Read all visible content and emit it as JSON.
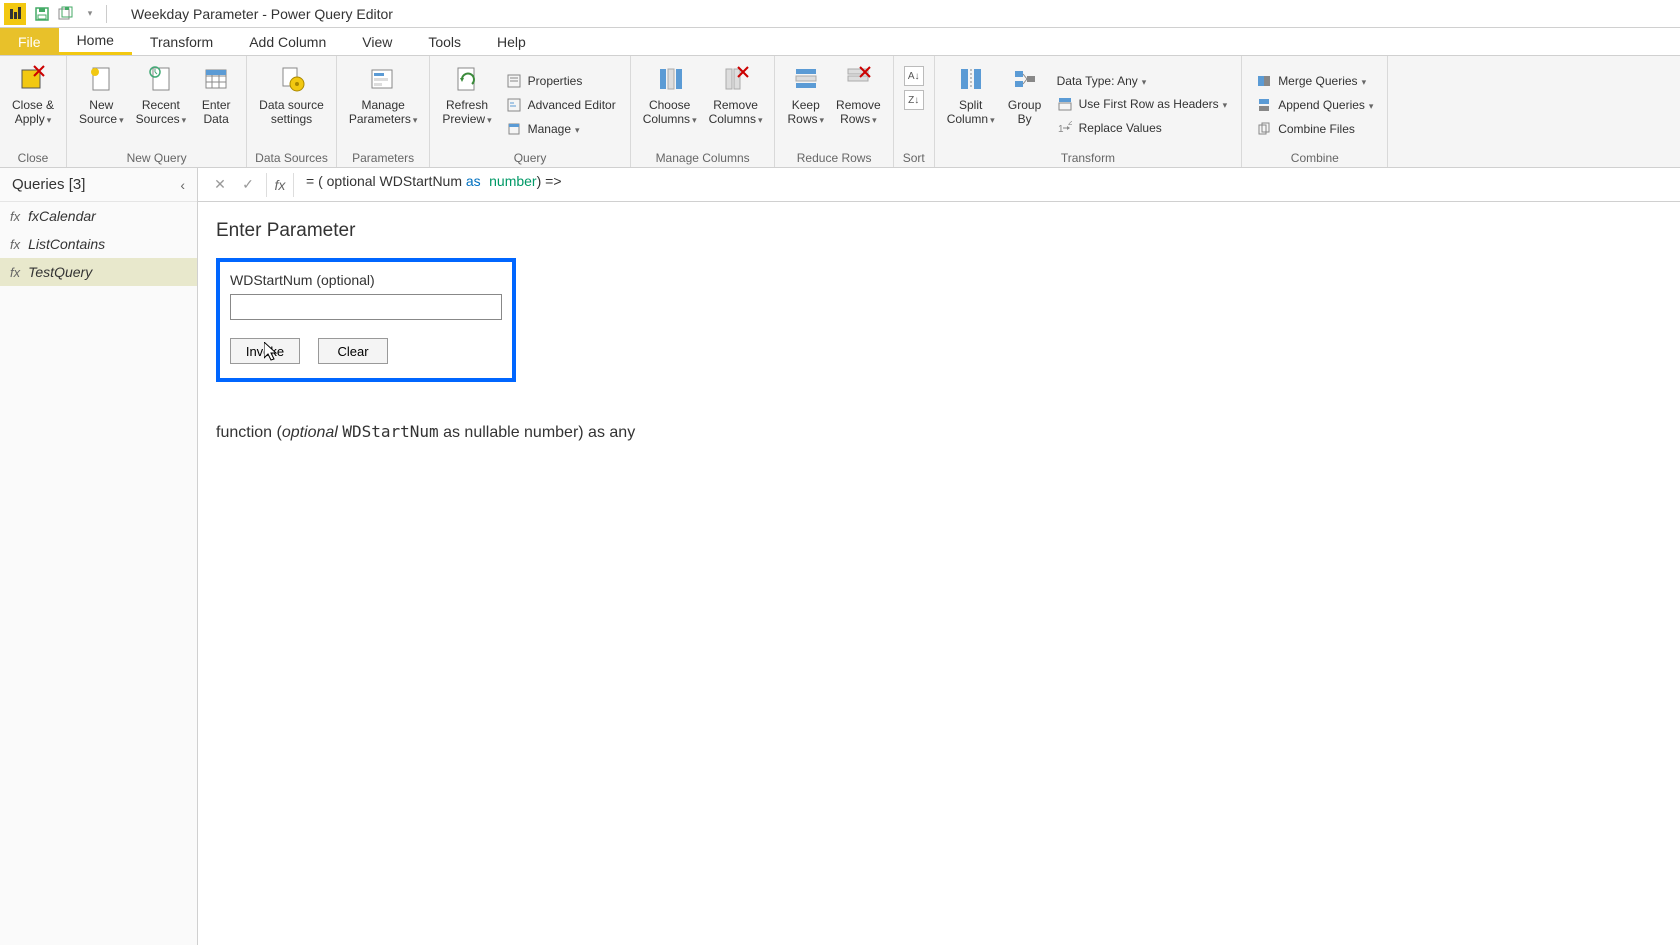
{
  "title": "Weekday Parameter - Power Query Editor",
  "tabs": {
    "file": "File",
    "home": "Home",
    "transform": "Transform",
    "addcol": "Add Column",
    "view": "View",
    "tools": "Tools",
    "help": "Help"
  },
  "ribbon": {
    "closeApply": "Close &\nApply",
    "closeGroup": "Close",
    "newSource": "New\nSource",
    "recentSources": "Recent\nSources",
    "enterData": "Enter\nData",
    "newQueryGroup": "New Query",
    "dataSourceSettings": "Data source\nsettings",
    "dataSourcesGroup": "Data Sources",
    "manageParameters": "Manage\nParameters",
    "parametersGroup": "Parameters",
    "refreshPreview": "Refresh\nPreview",
    "properties": "Properties",
    "advancedEditor": "Advanced Editor",
    "manage": "Manage",
    "queryGroup": "Query",
    "chooseColumns": "Choose\nColumns",
    "removeColumns": "Remove\nColumns",
    "manageColumnsGroup": "Manage Columns",
    "keepRows": "Keep\nRows",
    "removeRows": "Remove\nRows",
    "reduceRowsGroup": "Reduce Rows",
    "sortGroup": "Sort",
    "splitColumn": "Split\nColumn",
    "groupBy": "Group\nBy",
    "dataType": "Data Type: Any",
    "useFirstRow": "Use First Row as Headers",
    "replaceValues": "Replace Values",
    "transformGroup": "Transform",
    "mergeQueries": "Merge Queries",
    "appendQueries": "Append Queries",
    "combineFiles": "Combine Files",
    "combineGroup": "Combine"
  },
  "queries": {
    "header": "Queries [3]",
    "items": [
      {
        "name": "fxCalendar"
      },
      {
        "name": "ListContains"
      },
      {
        "name": "TestQuery"
      }
    ]
  },
  "formula": {
    "prefix": "= ( optional WDStartNum ",
    "as": "as",
    "type": "number",
    "suffix": ") =>"
  },
  "enterParam": {
    "title": "Enter Parameter",
    "label": "WDStartNum (optional)",
    "value": "",
    "invoke": "Invoke",
    "clear": "Clear"
  },
  "signature": {
    "p1": "function (",
    "optional": "optional ",
    "name": "WDStartNum",
    "p2": " as nullable number) as any"
  }
}
